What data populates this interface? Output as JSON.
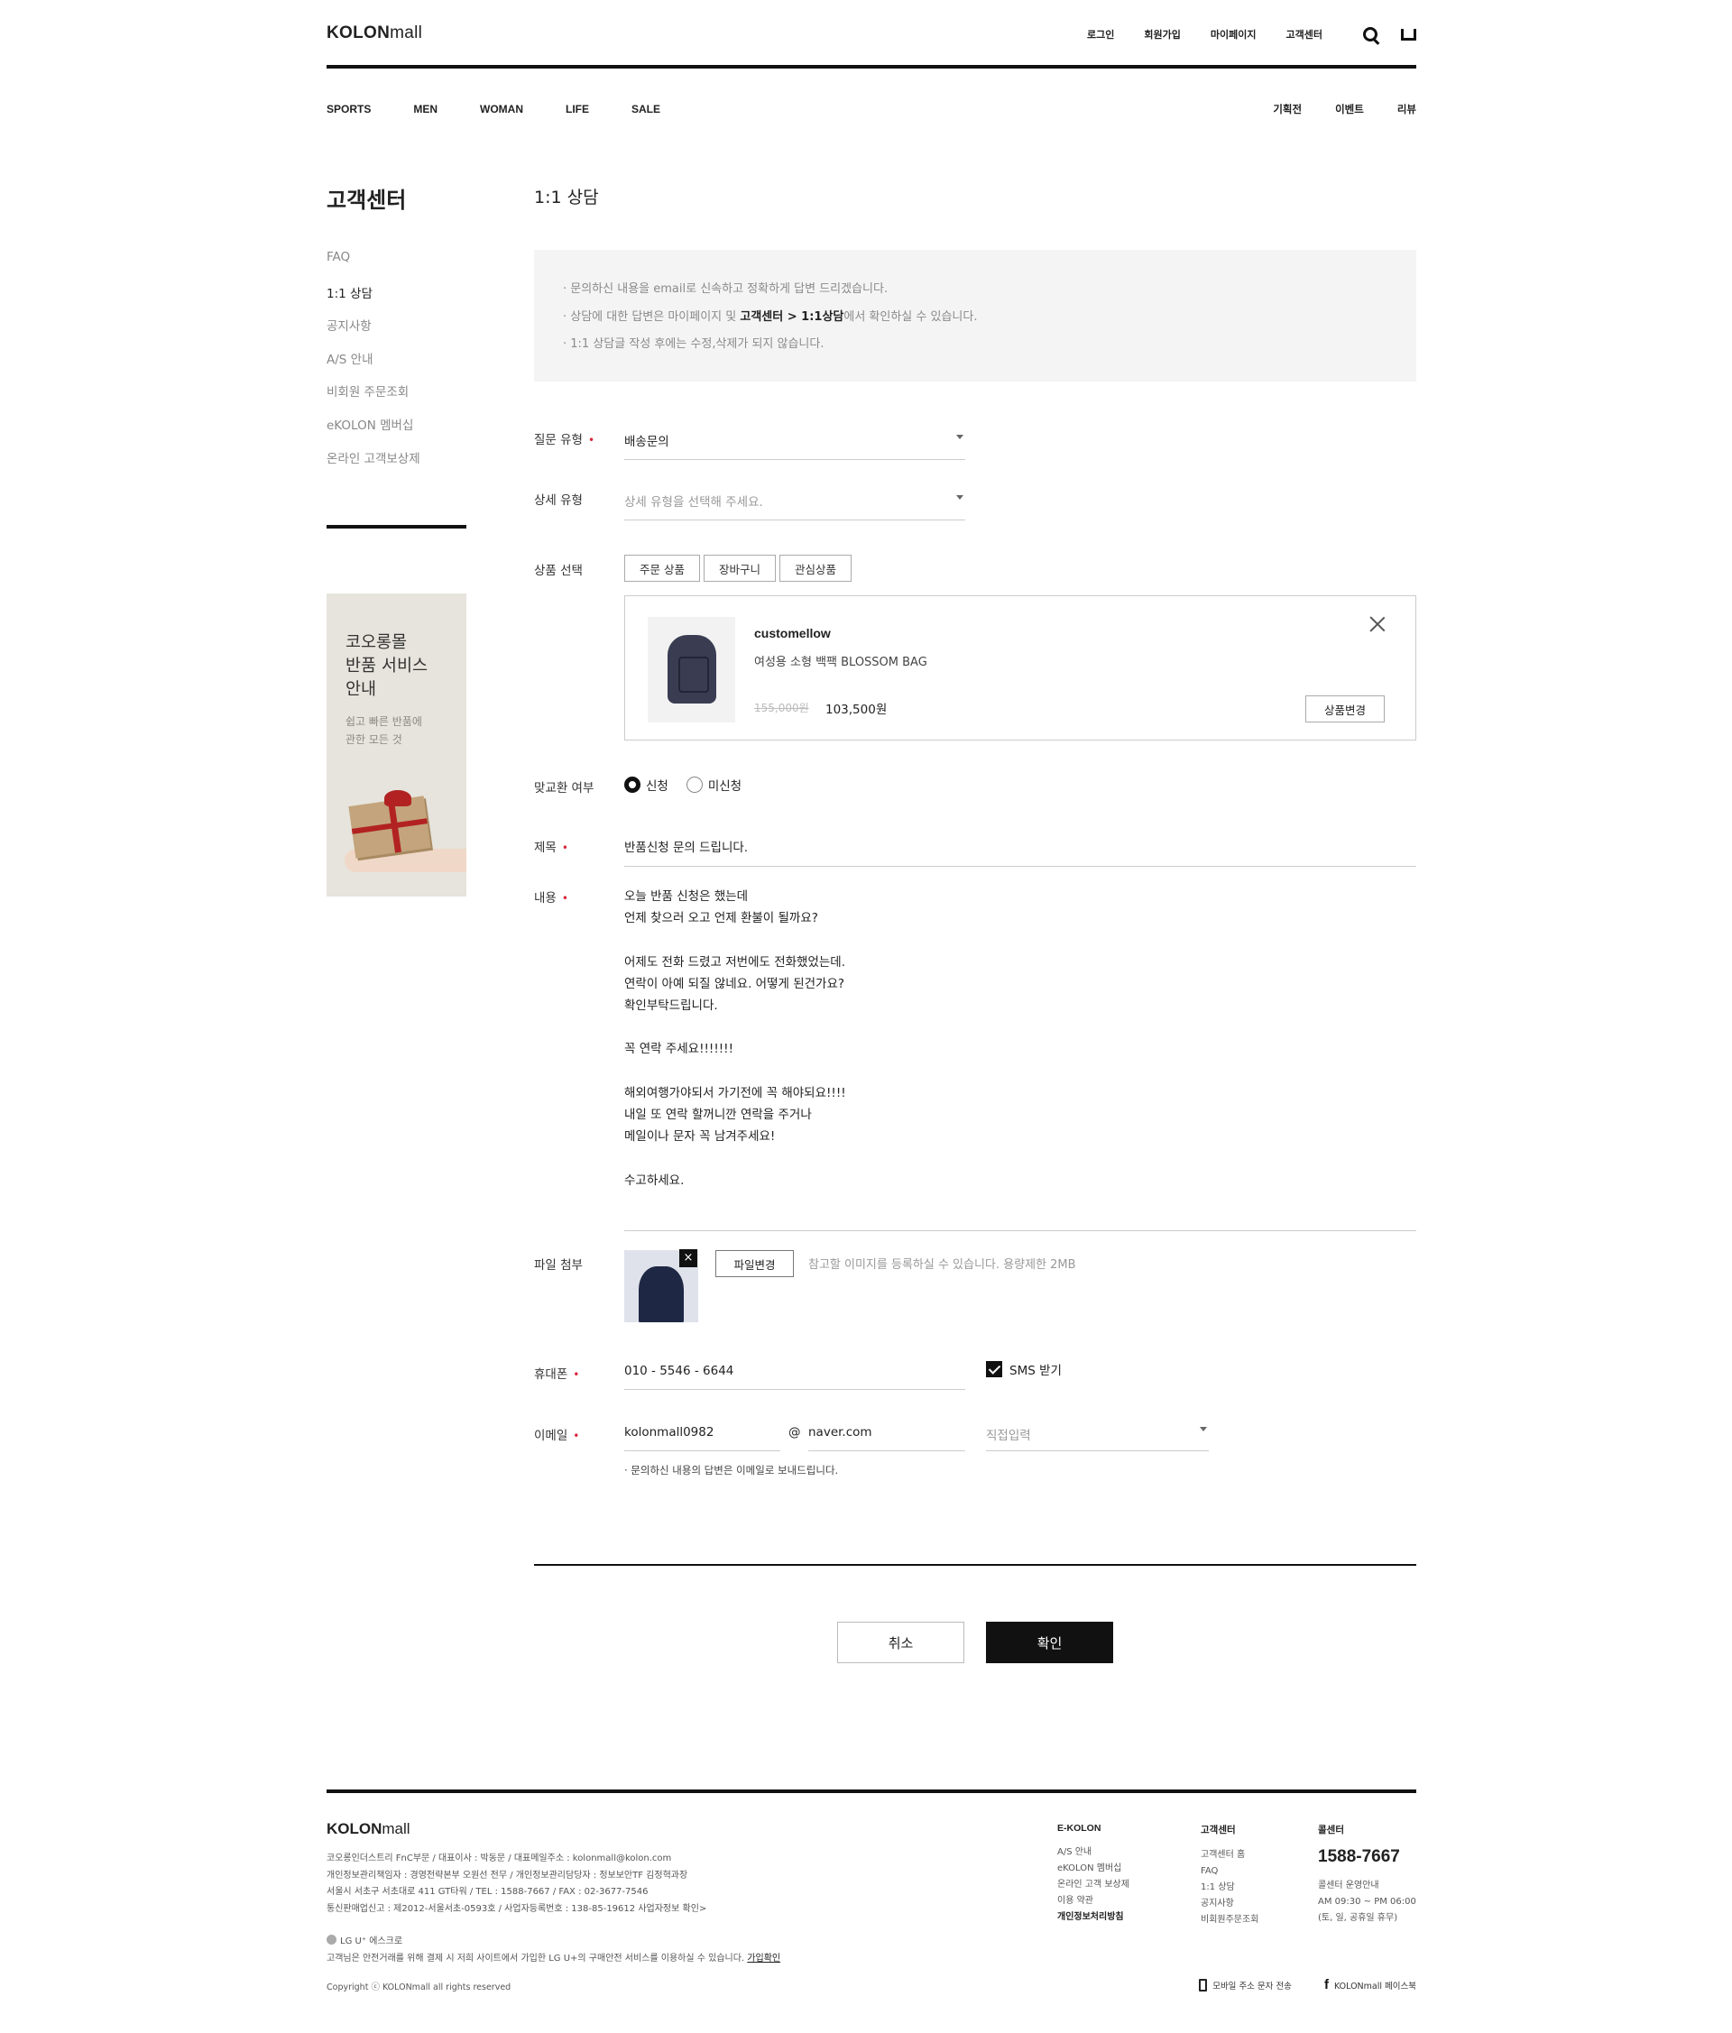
{
  "header": {
    "logo_bold": "KOLON",
    "logo_light": "mall",
    "util": [
      "로그인",
      "회원가입",
      "마이페이지",
      "고객센터"
    ],
    "gnb": [
      "SPORTS",
      "MEN",
      "WOMAN",
      "LIFE",
      "SALE"
    ],
    "gnb_right": [
      "기획전",
      "이벤트",
      "리뷰"
    ]
  },
  "sidebar": {
    "title": "고객센터",
    "items": [
      "FAQ",
      "1:1 상담",
      "공지사항",
      "A/S 안내",
      "비회원 주문조회",
      "eKOLON 멤버십",
      "온라인 고객보상제"
    ],
    "active_index": 1,
    "banner": {
      "title_lines": [
        "코오롱몰",
        "반품 서비스",
        "안내"
      ],
      "sub_lines": [
        "쉽고 빠른 반품에",
        "관한 모든 것"
      ]
    }
  },
  "main": {
    "title": "1:1 상담",
    "notice": {
      "line1": "· 문의하신 내용을 email로 신속하고 정확하게 답변 드리겠습니다.",
      "line2_pre": "· 상담에 대한 답변은 마이페이지 및 ",
      "line2_bold": "고객센터 > 1:1상담",
      "line2_post": "에서 확인하실 수 있습니다.",
      "line3": "· 1:1 상담글 작성 후에는 수정,삭제가 되지 않습니다."
    },
    "form": {
      "question_type_label": "질문 유형",
      "question_type_value": "배송문의",
      "detail_type_label": "상세 유형",
      "detail_type_placeholder": "상세 유형을 선택해 주세요.",
      "product_select_label": "상품 선택",
      "product_tabs": [
        "주문 상품",
        "장바구니",
        "관심상품"
      ],
      "product": {
        "brand": "customellow",
        "name": "여성용 소형 백팩 BLOSSOM BAG",
        "original_price": "155,000원",
        "price": "103,500원",
        "change_label": "상품변경"
      },
      "exchange_label": "맞교환 여부",
      "exchange_options": [
        "신청",
        "미신청"
      ],
      "exchange_selected": "신청",
      "subject_label": "제목",
      "subject_value": "반품신청 문의 드립니다.",
      "content_label": "내용",
      "content_lines": [
        "오늘 반품 신청은 했는데",
        "언제 찾으러 오고 언제 환불이 될까요?",
        "",
        "어제도 전화 드렸고 저번에도 전화했었는데.",
        "연락이 아예 되질 않네요. 어떻게 된건가요?",
        "확인부탁드립니다.",
        "",
        "꼭 연락 주세요!!!!!!!",
        "",
        "해외여행가야되서 가기전에 꼭 해야되요!!!!",
        "내일 또 연락 할꺼니깐 연락을 주거나",
        "메일이나 문자  꼭 남겨주세요!",
        "",
        "수고하세요."
      ],
      "attach_label": "파일 첨부",
      "attach_remove": "×",
      "attach_button": "파일변경",
      "attach_hint": "참고할 이미지를 등록하실 수 있습니다. 용량제한 2MB",
      "phone_label": "휴대폰",
      "phone_value": "010 - 5546 - 6644",
      "sms_label": "SMS 받기",
      "sms_checked": true,
      "email_label": "이메일",
      "email_id": "kolonmall0982",
      "email_at": "@",
      "email_domain": "naver.com",
      "email_select_placeholder": "직접입력",
      "email_note": "· 문의하신 내용의 답변은 이메일로 보내드립니다."
    },
    "buttons": {
      "cancel": "취소",
      "confirm": "확인"
    }
  },
  "footer": {
    "logo_bold": "KOLON",
    "logo_light": "mall",
    "info_lines": [
      "코오롱인더스트리 FnC부문 / 대표이사 : 박동문 / 대표메일주소 : kolonmall@kolon.com",
      "개인정보관리책임자 : 경영전략본부 오원선 전무 / 개인정보관리담당자 : 정보보안TF 김정혁과장",
      "서울시 서초구 서초대로 411 GT타워 / TEL : 1588-7667 / FAX : 02-3677-7546",
      "통신판매업신고 : 제2012-서울서초-0593호 / 사업자등록번호 : 138-85-19612  사업자정보 확인>"
    ],
    "lgu_label": "LG U⁺ 에스크로",
    "lgu_text": "고객님은 안전거래를 위해 결제 시 저희 사이트에서 가입한 LG U+의 구매안전 서비스를 이용하실 수 있습니다.",
    "lgu_link": "가입확인",
    "copyright": "Copyright ⓒ KOLONmall all rights reserved",
    "col1": {
      "title": "E-KOLON",
      "items": [
        "A/S 안내",
        "eKOLON 멤버십",
        "온라인 고객 보상제",
        "이용 약관",
        "개인정보처리방침"
      ]
    },
    "col2": {
      "title": "고객센터",
      "items": [
        "고객센터 홈",
        "FAQ",
        "1:1 상담",
        "공지사항",
        "비회원주문조회"
      ]
    },
    "col3": {
      "title": "콜센터",
      "phone": "1588-7667",
      "hours": [
        "콜센터 운영안내",
        "AM 09:30 ~ PM 06:00",
        "(토, 일, 공휴일 휴무)"
      ]
    },
    "links": [
      "모바일 주소 문자 전송",
      "KOLONmall 페이스북"
    ]
  }
}
